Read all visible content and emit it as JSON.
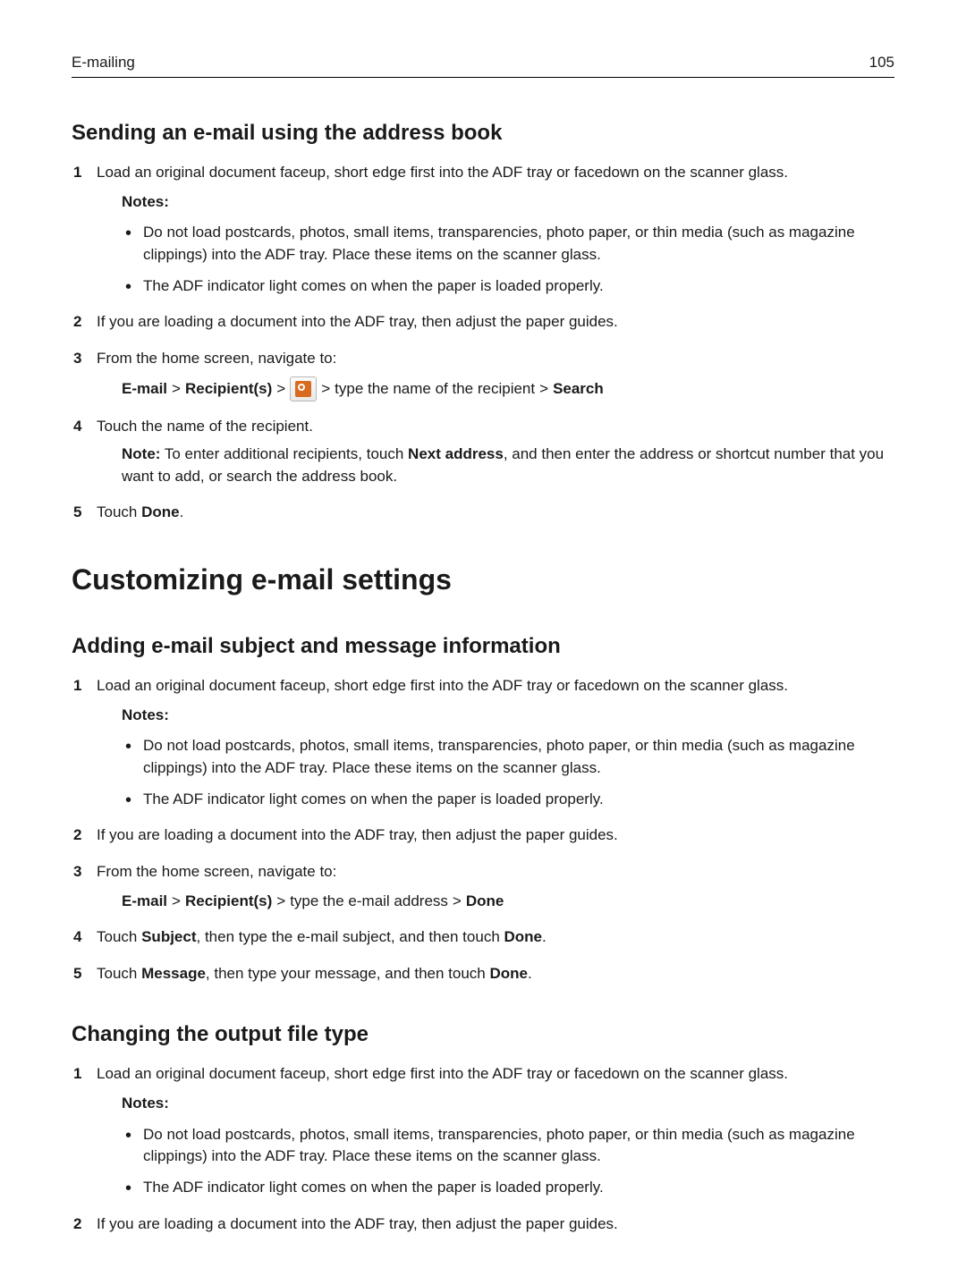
{
  "header": {
    "section": "E-mailing",
    "page_number": "105"
  },
  "section1": {
    "title": "Sending an e‑mail using the address book",
    "step1": "Load an original document faceup, short edge first into the ADF tray or facedown on the scanner glass.",
    "notes_label": "Notes:",
    "note1": "Do not load postcards, photos, small items, transparencies, photo paper, or thin media (such as magazine clippings) into the ADF tray. Place these items on the scanner glass.",
    "note2": "The ADF indicator light comes on when the paper is loaded properly.",
    "step2": "If you are loading a document into the ADF tray, then adjust the paper guides.",
    "step3": "From the home screen, navigate to:",
    "nav": {
      "email": "E‑mail",
      "gt1": ">",
      "recipients": "Recipient(s)",
      "gt2": ">",
      "gt3": ">",
      "mid": "type the name of the recipient",
      "gt4": ">",
      "search": "Search"
    },
    "step4": "Touch the name of the recipient.",
    "step4_note_prefix": "Note:",
    "step4_note_a": " To enter additional recipients, touch ",
    "step4_note_bold": "Next address",
    "step4_note_b": ", and then enter the address or shortcut number that you want to add, or search the address book.",
    "step5_a": "Touch ",
    "step5_bold": "Done",
    "step5_b": "."
  },
  "chapter": {
    "title": "Customizing e‑mail settings"
  },
  "section2": {
    "title": "Adding e‑mail subject and message information",
    "step1": "Load an original document faceup, short edge first into the ADF tray or facedown on the scanner glass.",
    "notes_label": "Notes:",
    "note1": "Do not load postcards, photos, small items, transparencies, photo paper, or thin media (such as magazine clippings) into the ADF tray. Place these items on the scanner glass.",
    "note2": "The ADF indicator light comes on when the paper is loaded properly.",
    "step2": "If you are loading a document into the ADF tray, then adjust the paper guides.",
    "step3": "From the home screen, navigate to:",
    "nav": {
      "email": "E‑mail",
      "gt1": ">",
      "recipients": "Recipient(s)",
      "gt2": ">",
      "mid": "type the e‑mail address",
      "gt3": ">",
      "done": "Done"
    },
    "step4_a": "Touch ",
    "step4_b1": "Subject",
    "step4_c": ", then type the e‑mail subject, and then touch ",
    "step4_b2": "Done",
    "step4_d": ".",
    "step5_a": "Touch ",
    "step5_b1": "Message",
    "step5_c": ", then type your message, and then touch ",
    "step5_b2": "Done",
    "step5_d": "."
  },
  "section3": {
    "title": "Changing the output file type",
    "step1": "Load an original document faceup, short edge first into the ADF tray or facedown on the scanner glass.",
    "notes_label": "Notes:",
    "note1": "Do not load postcards, photos, small items, transparencies, photo paper, or thin media (such as magazine clippings) into the ADF tray. Place these items on the scanner glass.",
    "note2": "The ADF indicator light comes on when the paper is loaded properly.",
    "step2": "If you are loading a document into the ADF tray, then adjust the paper guides."
  }
}
